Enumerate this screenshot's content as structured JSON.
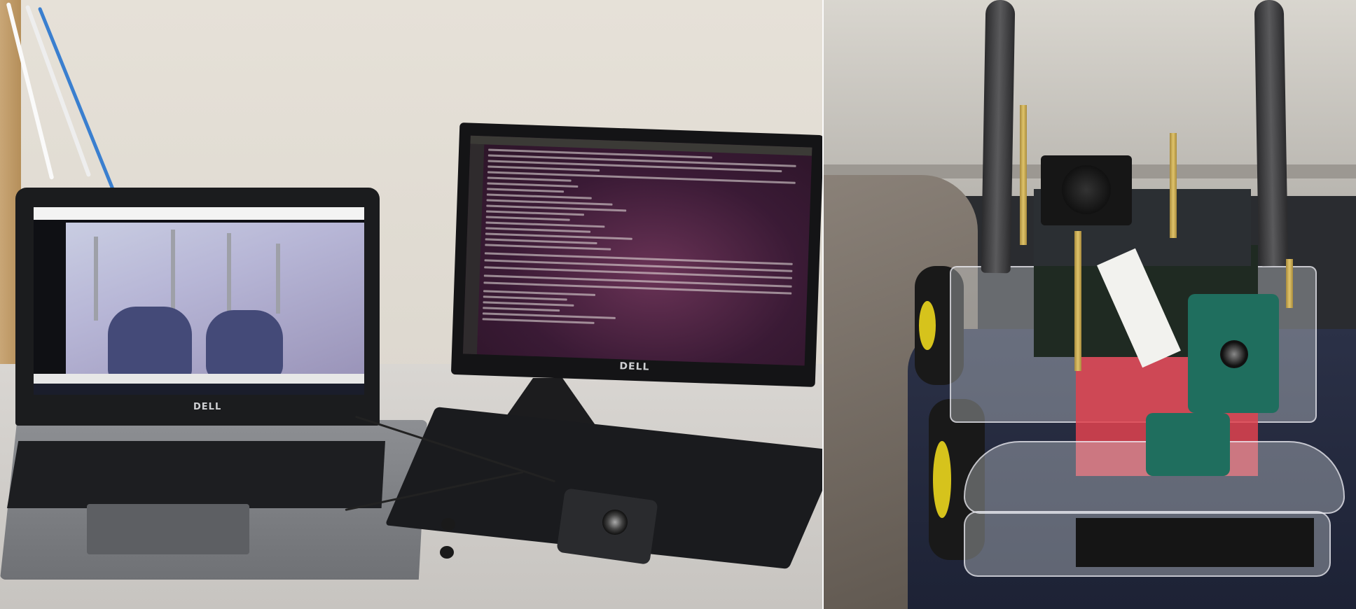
{
  "left_photo": {
    "laptop_brand": "DELL",
    "monitor_brand": "DELL"
  },
  "right_photo": {},
  "colors": {
    "terminal_background": "#3a1a35",
    "camera_mount": "#1f6e5e",
    "wheel_rim": "#d6c31c",
    "acrylic_red_board": "#e0424f"
  }
}
